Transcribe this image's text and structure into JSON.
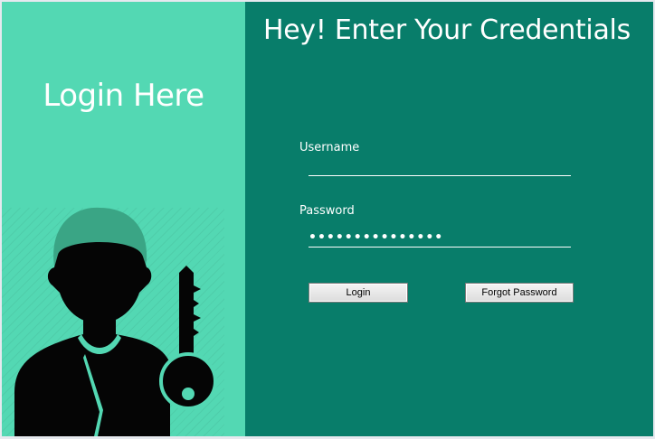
{
  "left": {
    "heading": "Login Here"
  },
  "right": {
    "title": "Hey! Enter Your Credentials",
    "username": {
      "label": "Username",
      "value": ""
    },
    "password": {
      "label": "Password",
      "value": "•••••••••••••••"
    },
    "buttons": {
      "login": "Login",
      "forgot": "Forgot Password"
    }
  },
  "icons": [
    "user-key-icon"
  ],
  "colors": {
    "left_panel": "#53d8b3",
    "right_panel": "#087d6a",
    "text": "#ffffff"
  }
}
